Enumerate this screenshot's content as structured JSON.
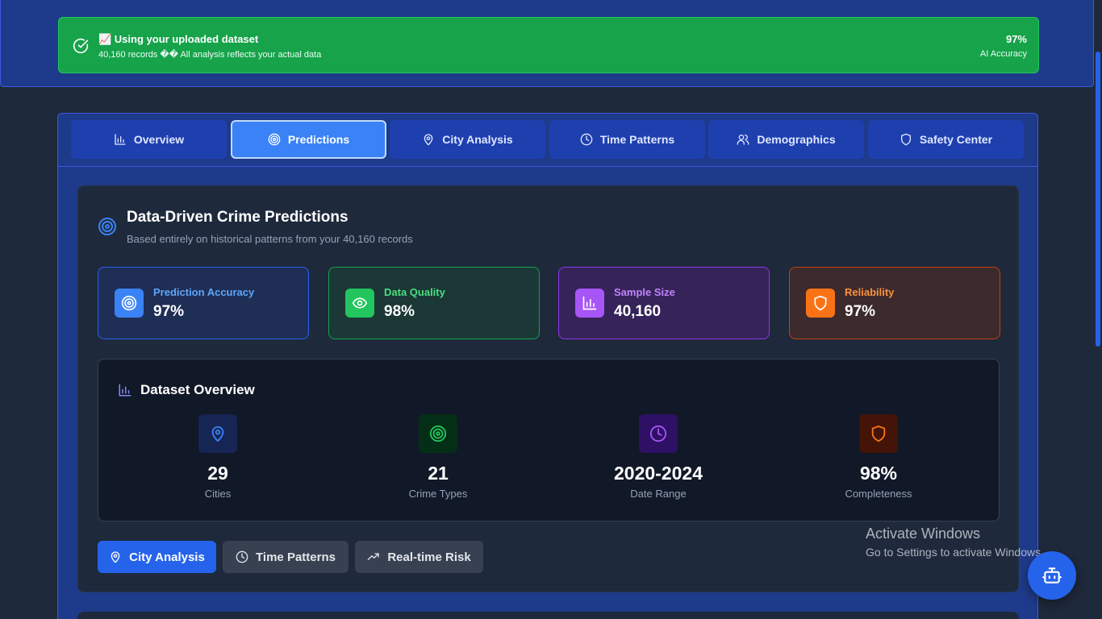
{
  "banner": {
    "title": "📈 Using your uploaded dataset",
    "subtitle": "40,160 records �� All analysis reflects your actual data",
    "accuracy_value": "97%",
    "accuracy_label": "AI Accuracy",
    "icon": "check-circle-icon"
  },
  "tabs": [
    {
      "label": "Overview",
      "icon": "bar-chart-icon",
      "active": false
    },
    {
      "label": "Predictions",
      "icon": "target-icon",
      "active": true
    },
    {
      "label": "City Analysis",
      "icon": "map-pin-icon",
      "active": false
    },
    {
      "label": "Time Patterns",
      "icon": "clock-icon",
      "active": false
    },
    {
      "label": "Demographics",
      "icon": "users-icon",
      "active": false
    },
    {
      "label": "Safety Center",
      "icon": "shield-icon",
      "active": false
    }
  ],
  "predictions": {
    "title": "Data-Driven Crime Predictions",
    "subtitle": "Based entirely on historical patterns from your 40,160 records",
    "stats": [
      {
        "label": "Prediction Accuracy",
        "value": "97%",
        "icon": "target-icon",
        "color": "#3b82f6"
      },
      {
        "label": "Data Quality",
        "value": "98%",
        "icon": "eye-icon",
        "color": "#22c55e"
      },
      {
        "label": "Sample Size",
        "value": "40,160",
        "icon": "bar-chart-icon",
        "color": "#a855f7"
      },
      {
        "label": "Reliability",
        "value": "97%",
        "icon": "shield-icon",
        "color": "#f97316"
      }
    ]
  },
  "overview": {
    "title": "Dataset Overview",
    "items": [
      {
        "value": "29",
        "label": "Cities",
        "icon": "map-pin-icon"
      },
      {
        "value": "21",
        "label": "Crime Types",
        "icon": "target-icon"
      },
      {
        "value": "2020-2024",
        "label": "Date Range",
        "icon": "clock-icon"
      },
      {
        "value": "98%",
        "label": "Completeness",
        "icon": "shield-icon"
      }
    ]
  },
  "actions": [
    {
      "label": "City Analysis",
      "icon": "map-pin-icon",
      "style": "primary"
    },
    {
      "label": "Time Patterns",
      "icon": "clock-icon",
      "style": "secondary"
    },
    {
      "label": "Real-time Risk",
      "icon": "trending-up-icon",
      "style": "secondary"
    }
  ],
  "watermark": {
    "title": "Activate Windows",
    "subtitle": "Go to Settings to activate Windows."
  },
  "assistant": {
    "icon": "robot-icon"
  }
}
